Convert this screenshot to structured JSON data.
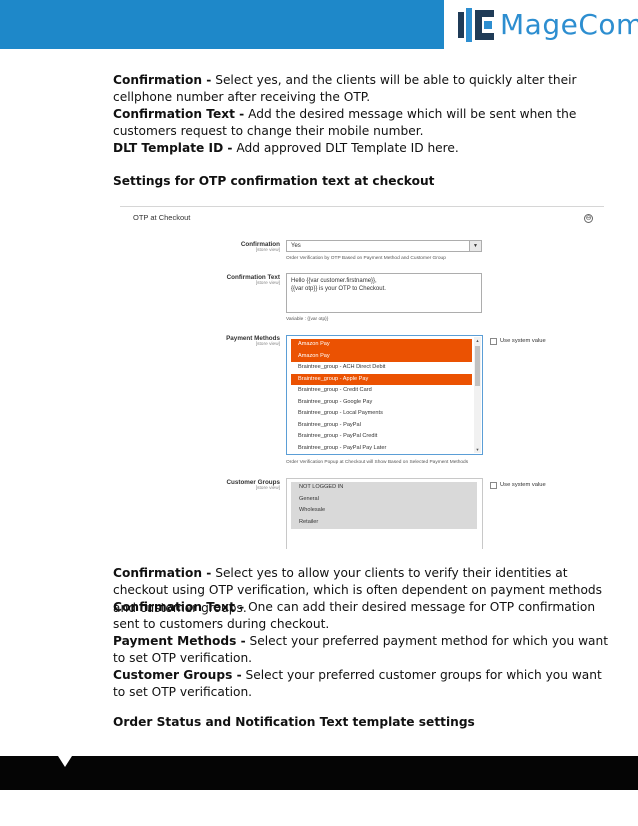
{
  "brand": {
    "name": "MageComp",
    "colors": {
      "header": "#1e88c9",
      "accent": "#eb5202"
    }
  },
  "intro": [
    {
      "term": "Confirmation -",
      "text": " Select yes, and the clients will be able to quickly alter their cellphone number after receiving the OTP."
    },
    {
      "term": "Confirmation Text -",
      "text": "  Add the desired message which will be sent when the customers request to change their mobile number."
    },
    {
      "term": "DLT Template ID -",
      "text": " Add approved DLT Template ID here."
    }
  ],
  "heading1": "Settings for OTP confirmation text at checkout",
  "screenshot": {
    "section_title": "OTP at Checkout",
    "collapse_symbol": "⊖",
    "confirmation": {
      "label": "Confirmation",
      "scope": "[store view]",
      "value": "Yes",
      "note": "Order Verification by OTP Based on Payment Method and Customer Group"
    },
    "confirmation_text": {
      "label": "Confirmation Text",
      "scope": "[store view]",
      "lines": [
        "Hello {{var customer.firstname}},",
        "{{var otp}} is your OTP to Checkout."
      ],
      "note": "Variable : {{var otp}}"
    },
    "payment_methods": {
      "label": "Payment Methods",
      "scope": "[store view]",
      "options": [
        {
          "label": "Amazon Pay",
          "selected": true
        },
        {
          "label": "Amazon Pay",
          "selected": true
        },
        {
          "label": "Braintree_group - ACH Direct Debit",
          "selected": false
        },
        {
          "label": "Braintree_group - Apple Pay",
          "selected": true
        },
        {
          "label": "Braintree_group - Credit Card",
          "selected": false
        },
        {
          "label": "Braintree_group - Google Pay",
          "selected": false
        },
        {
          "label": "Braintree_group - Local Payments",
          "selected": false
        },
        {
          "label": "Braintree_group - PayPal",
          "selected": false
        },
        {
          "label": "Braintree_group - PayPal Credit",
          "selected": false
        },
        {
          "label": "Braintree_group - PayPal Pay Later",
          "selected": false
        }
      ],
      "use_system_value": "Use system value",
      "note": "Order Verification Popup at Checkout will Show Based on Selected Payment Methods"
    },
    "customer_groups": {
      "label": "Customer Groups",
      "scope": "[store view]",
      "options": [
        "NOT LOGGED IN",
        "General",
        "Wholesale",
        "Retailer"
      ],
      "use_system_value": "Use system value"
    }
  },
  "details": [
    {
      "term": "Confirmation -",
      "text": "  Select yes to allow your clients to verify their identities at checkout using OTP verification, which is often dependent on payment methods and customer groups."
    },
    {
      "term": "Confirmation Text -",
      "text": " One can add their desired message for OTP confirmation sent to customers during checkout."
    },
    {
      "term": "Payment Methods -",
      "text": " Select your preferred payment method for which you want to set OTP verification."
    },
    {
      "term": "Customer Groups -",
      "text": "  Select your preferred customer groups for which you want to set OTP verification."
    }
  ],
  "heading2": "Order Status and Notification Text template settings"
}
